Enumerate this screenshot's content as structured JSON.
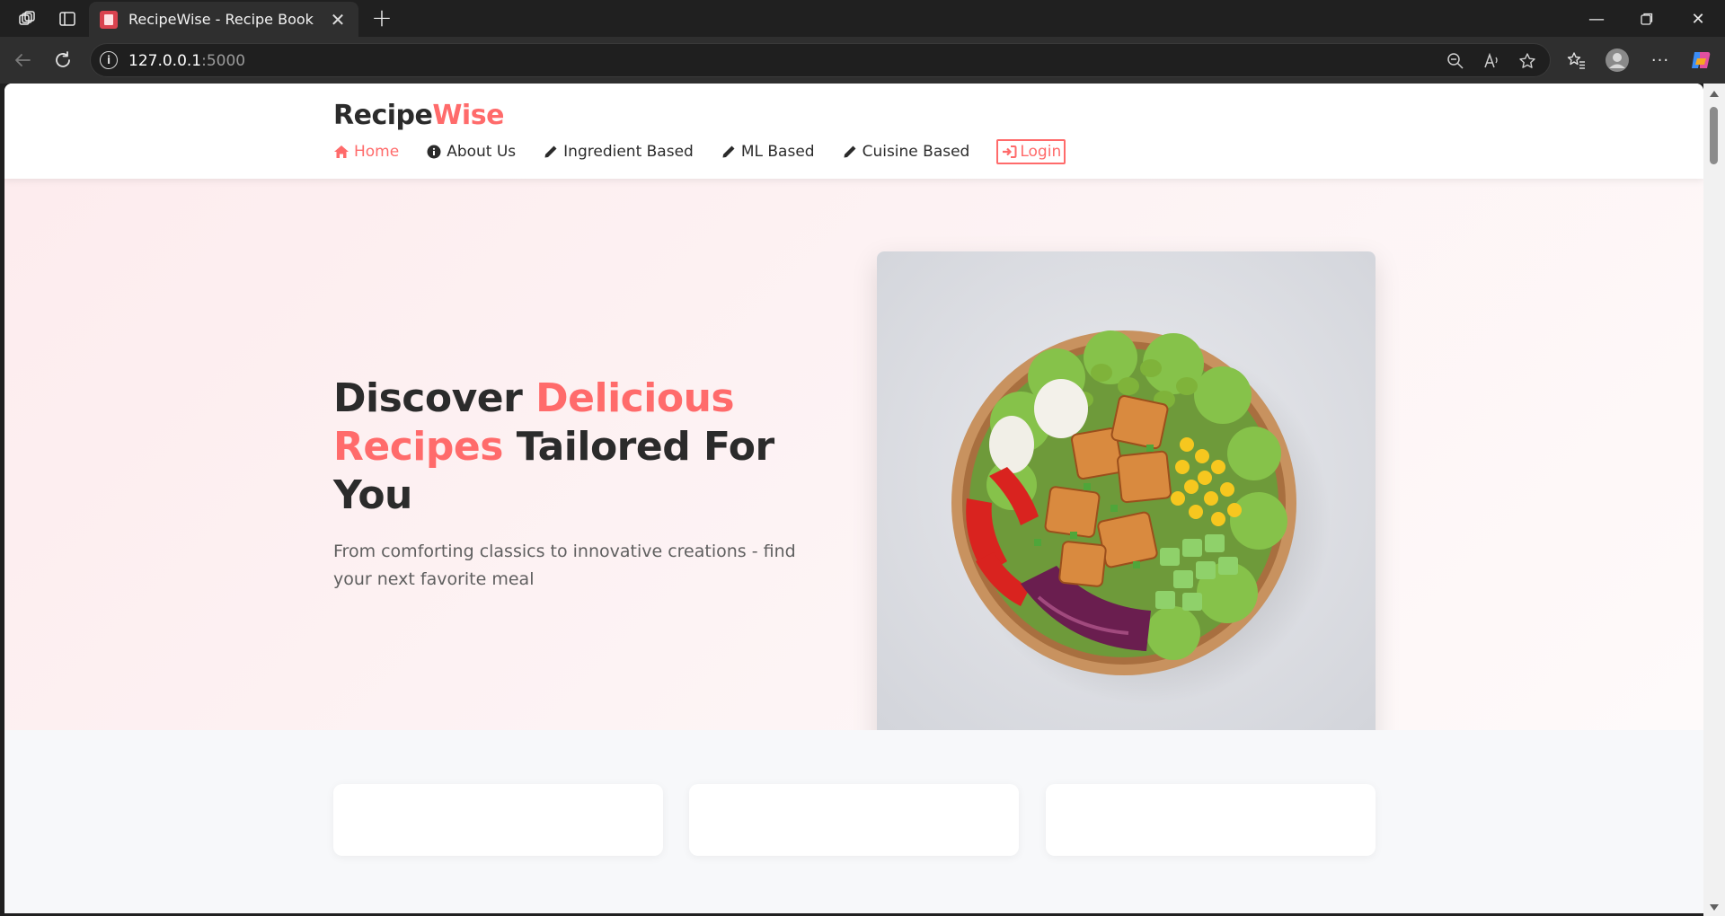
{
  "browser": {
    "tab_title": "RecipeWise - Recipe Book",
    "address_host": "127.0.0.1",
    "address_port": ":5000",
    "tab_close_glyph": "✕",
    "new_tab_glyph": "+",
    "minimize_glyph": "—",
    "close_glyph": "✕",
    "more_glyph": "···"
  },
  "site": {
    "brand_main": "Recipe",
    "brand_accent": "Wise",
    "nav": [
      {
        "label": "Home",
        "icon": "home-icon",
        "active": true
      },
      {
        "label": "About Us",
        "icon": "info-icon",
        "active": false
      },
      {
        "label": "Ingredient Based",
        "icon": "pencil-icon",
        "active": false
      },
      {
        "label": "ML Based",
        "icon": "pencil-icon",
        "active": false
      },
      {
        "label": "Cuisine Based",
        "icon": "pencil-icon",
        "active": false
      }
    ],
    "login_label": "Login"
  },
  "hero": {
    "title_part1": "Discover ",
    "title_accent": "Delicious Recipes",
    "title_part2": " Tailored For You",
    "subtitle": "From comforting classics to innovative creations - find your next favorite meal"
  },
  "colors": {
    "accent": "#ff6b6b",
    "text_dark": "#2b2b2b",
    "hero_bg": "#fdecee"
  }
}
